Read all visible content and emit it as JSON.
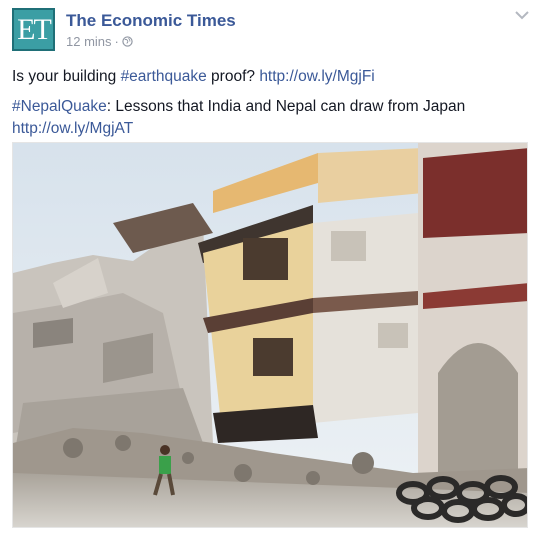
{
  "post": {
    "avatar_text": "ET",
    "page_name": "The Economic Times",
    "timestamp": "12 mins",
    "separator": "·",
    "privacy_icon": "globe-icon",
    "menu_icon": "chevron-down-icon",
    "line1": {
      "prefix": "Is your building ",
      "hashtag": "#earthquake",
      "middle": " proof? ",
      "url": "http://ow.ly/MgjFi"
    },
    "line2": {
      "hashtag": "#NepalQuake",
      "text": ": Lessons that India and Nepal can draw from Japan",
      "url": "http://ow.ly/MgjAT"
    },
    "photo_subject": "collapsed buildings after earthquake"
  },
  "colors": {
    "brand_link": "#3b5998",
    "meta_gray": "#9197a3",
    "avatar_bg": "#3b9ea4"
  }
}
